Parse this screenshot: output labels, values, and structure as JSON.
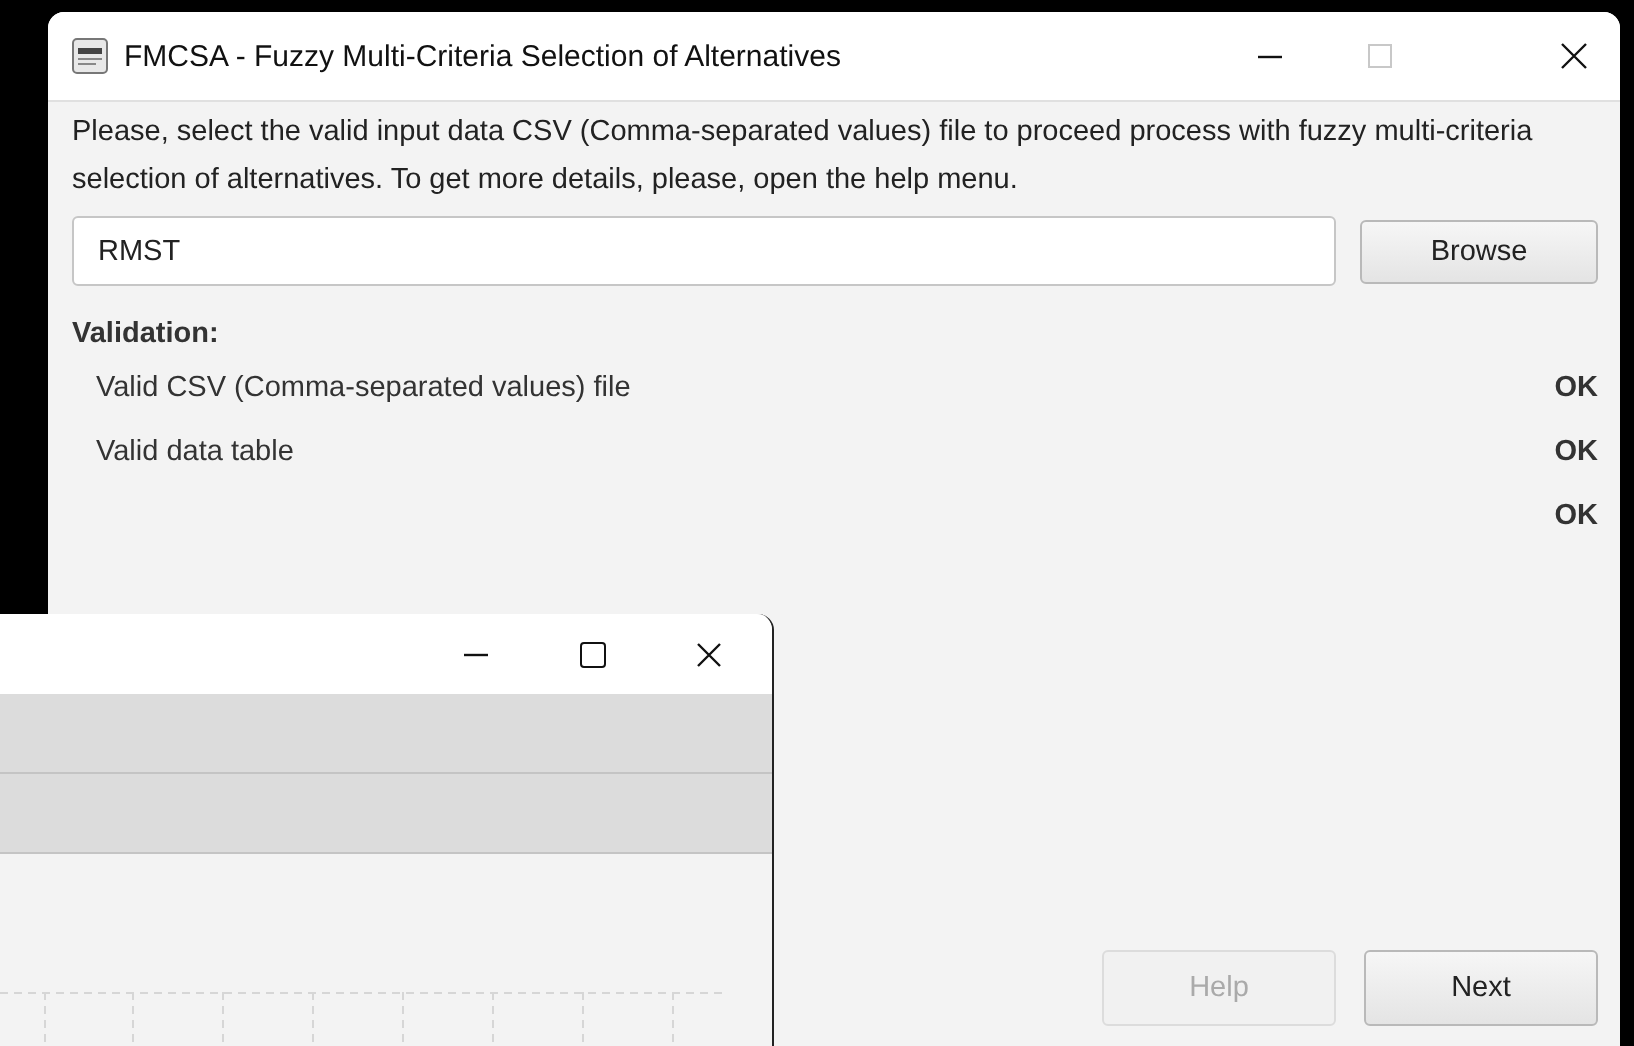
{
  "window": {
    "title": "FMCSA - Fuzzy Multi-Criteria Selection of Alternatives",
    "maximize_disabled": true
  },
  "description": "Please, select the valid input data CSV (Comma-separated values) file to proceed process with fuzzy multi-criteria selection of alternatives. To get more details, please, open the help menu.",
  "file_field": {
    "value": "RMST"
  },
  "browse_button": "Browse",
  "validation": {
    "heading": "Validation:",
    "rows": [
      {
        "label": "Valid CSV (Comma-separated values) file",
        "status": "OK"
      },
      {
        "label": "Valid data table",
        "status": "OK"
      },
      {
        "status": "OK"
      }
    ]
  },
  "buttons": [
    {
      "label": "Help",
      "disabled": true
    },
    {
      "label": "Next",
      "disabled": false
    }
  ]
}
